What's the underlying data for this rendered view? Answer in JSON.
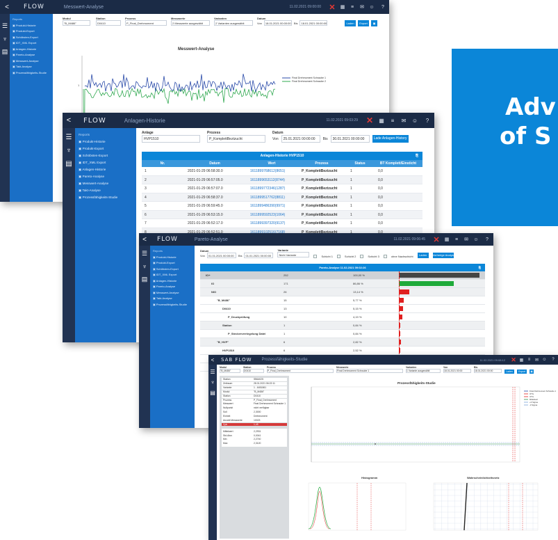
{
  "banner": {
    "line1": "Adv",
    "line2": "of S",
    "color": "#0b86d8"
  },
  "common": {
    "back": "<",
    "brand": "FLOW",
    "menu_title": "Reports",
    "menu_items": [
      "Produkt-Historie",
      "Produkt-Export",
      "Schöbsten-Export",
      "IDT_XML Export",
      "Anlagen-Historie",
      "Pareto-Analyse",
      "Messwert-Analyse",
      "Takt-Analyse",
      "Prozessfähigkeits-Studie"
    ],
    "icons": [
      "database-icon",
      "stethoscope-icon",
      "document-icon"
    ]
  },
  "win1": {
    "subtitle": "Messwert-Analyse",
    "timestamp": "11.02.2021 09:00:00",
    "filters": [
      {
        "label": "Modul",
        "value": "\"B_M486\""
      },
      {
        "label": "Station",
        "value": "D0410"
      },
      {
        "label": "Prozess",
        "value": "P_Final_Drehmoment"
      },
      {
        "label": "Messwerte",
        "value": "2 Messwerte ausgewählt"
      },
      {
        "label": "Varianten",
        "value": "2 Varianten ausgewählt"
      },
      {
        "label": "Datum",
        "value": ""
      }
    ],
    "von": "Von",
    "von_value": "18.01.2021 00:00:00",
    "bis": "Bis",
    "bis_value": "18.01.2021 00:00:00",
    "load": "Laden",
    "export": "Export",
    "chart_title": "Messwert-Analyse",
    "legend": [
      "Final Drehmoment Schraube 1",
      "Final Drehmoment Schraube 2"
    ],
    "ytick": "1"
  },
  "win2": {
    "subtitle": "Anlagen-Historie",
    "timestamp": "11.02.2021 09:03:29",
    "anlage_label": "Anlage",
    "anlage_value": "HVP1510",
    "prozess_label": "Prozess",
    "prozess_value": "P_KomplettBeztzucht",
    "datum_label": "Datum",
    "von": "Von",
    "von_value": "25.01.2021 00:00:00",
    "bis": "Bis",
    "bis_value": "30.01.2021 00:00:00",
    "load": "Lade Anlagen-History",
    "table_title": "Anlagen-Historie HVP1510",
    "columns": [
      "Nr.",
      "Datum",
      "Wert",
      "Prozess",
      "Status",
      "BT Komplett/Einsticht"
    ],
    "rows": [
      [
        "1",
        "2021-01-29 06:58:30.0",
        "1611899768612(8651)",
        "P_KomplettBeztzucht",
        "1",
        "0,0"
      ],
      [
        "2",
        "2021-01-29 06:57:05.0",
        "1611899653112(8744)",
        "P_KomplettBeztzucht",
        "1",
        "0,0"
      ],
      [
        "3",
        "2021-01-29 06:57:07.0",
        "1611899772346(1287)",
        "P_KomplettBeztzucht",
        "1",
        "0,0"
      ],
      [
        "4",
        "2021-01-29 06:58:37.0",
        "1611899517762(8811)",
        "P_KomplettBeztzucht",
        "1",
        "0,0"
      ],
      [
        "5",
        "2021-01-29 06:59:45.0",
        "1611899486390(9971)",
        "P_KomplettBeztzucht",
        "1",
        "0,0"
      ],
      [
        "6",
        "2021-01-29 06:53:15.0",
        "1611899592523(1064)",
        "P_KomplettBeztzucht",
        "1",
        "0,0"
      ],
      [
        "7",
        "2021-01-29 06:52:17.0",
        "1611899397320(9137)",
        "P_KomplettBeztzucht",
        "1",
        "0,0"
      ],
      [
        "8",
        "2021-01-29 06:52:51.0",
        "1611899102516(7168)",
        "P_KomplettBeztzucht",
        "1",
        "0,0"
      ]
    ]
  },
  "win3": {
    "subtitle": "Pareto-Analyse",
    "timestamp": "11.02.2021 09:06:45",
    "datum_label": "Datum",
    "von": "Von",
    "von_value": "01.01.2021 00:00:00",
    "bis": "Bis",
    "bis_value": "01.01.2021 00:00:00",
    "variante_label": "Variante",
    "variante_value": "Nicht Variante",
    "checks": [
      "Schicht 1",
      "Schicht 2",
      "Schicht 3",
      "ohne Nachschicht"
    ],
    "load": "Laden",
    "prev": "Vorherige Analyse",
    "table_title": "Pareto-Analyse 11.02.2021 09:02:26",
    "rows": [
      {
        "label": "IO+",
        "count": "252",
        "pct": "100,00 %",
        "bar": 1.0,
        "color": "#444444",
        "cls": "gray",
        "indent": 1
      },
      {
        "label": "IO",
        "count": "171",
        "pct": "86,86 %",
        "bar": 0.68,
        "color": "#1faa3a",
        "cls": "light",
        "indent": 2
      },
      {
        "label": "NIO",
        "count": "26",
        "pct": "13,14 %",
        "bar": 0.13,
        "color": "#e02020",
        "cls": "light",
        "indent": 2
      },
      {
        "label": "\"B_M486\"",
        "count": "15",
        "pct": "5,77 %",
        "bar": 0.06,
        "color": "#e02020",
        "cls": "",
        "indent": 3
      },
      {
        "label": "D0410",
        "count": "13",
        "pct": "5,15 %",
        "bar": 0.05,
        "color": "#e02020",
        "cls": "",
        "indent": 4
      },
      {
        "label": "P_Druckprüfung",
        "count": "10",
        "pct": "4,19 %",
        "bar": 0.04,
        "color": "#e02020",
        "cls": "",
        "indent": 5
      },
      {
        "label": "Station",
        "count": "1",
        "pct": "0,84 %",
        "bar": 0.0,
        "color": "#e02020",
        "cls": "light",
        "indent": 4
      },
      {
        "label": "P_Steckerverriegelung Datei",
        "count": "1",
        "pct": "0,84 %",
        "bar": 0.0,
        "color": "#e02020",
        "cls": "",
        "indent": 5
      },
      {
        "label": "\"B_HVP\"",
        "count": "6",
        "pct": "2,82 %",
        "bar": 0.03,
        "color": "#e02020",
        "cls": "light",
        "indent": 3
      },
      {
        "label": "HVP1510",
        "count": "6",
        "pct": "2,52 %",
        "bar": 0.02,
        "color": "#e02020",
        "cls": "",
        "indent": 4
      },
      {
        "label": "P_Herunterfuhrt",
        "count": "4",
        "pct": "0,43 %",
        "bar": 0.01,
        "color": "#e02020",
        "cls": "",
        "indent": 5
      },
      {
        "label": "P_Einrasten",
        "count": "1",
        "pct": "0,43 %",
        "bar": 0.01,
        "color": "#e02020",
        "cls": "",
        "indent": 5
      }
    ]
  },
  "win4": {
    "brand": "SAB FLOW",
    "subtitle": "Prozessfähigkeits-Studie",
    "timestamp": "11.02.2021 09:08:12",
    "filters": [
      {
        "label": "Modul",
        "value": "\"B_M486\""
      },
      {
        "label": "Station",
        "value": "D0410"
      },
      {
        "label": "Prozess",
        "value": "P_Final_Drehmoment"
      },
      {
        "label": "Messwerte",
        "value": "Final Drehmoment Schraube 1"
      },
      {
        "label": "Varianten",
        "value": "1 Variante ausgewählt"
      },
      {
        "label": "Von",
        "value": "18.01.2021 00:00"
      },
      {
        "label": "Bis",
        "value": "18.01.2021 00:00"
      }
    ],
    "load": "Laden",
    "export": "Export",
    "info": [
      [
        "Station",
        "SB64025"
      ],
      [
        "Zeitraum",
        "28.01.2021 06:22:11"
      ],
      [
        "Variante",
        "1 - 6451861"
      ],
      [
        "Modul",
        "\"B_M486\""
      ],
      [
        "Station",
        "D0410"
      ],
      [
        "Prozess",
        "P_Final_Drehmoment"
      ],
      [
        "Messwert",
        "Final Drehmoment Schraube 1"
      ],
      [
        "Nullpunkt",
        "nicht verfügbar"
      ],
      [
        "Soll",
        "2,3000"
      ],
      [
        "Einheit",
        "Drehmoment"
      ],
      [
        "Anzahl Messwerte",
        "10023"
      ]
    ],
    "info_red": [
      "Cpk",
      "1,45"
    ],
    "info2": [
      [
        "Mittelwert",
        "2,2931"
      ],
      [
        "Std.Abw.",
        "0,0041"
      ],
      [
        "Min",
        "2,2740"
      ],
      [
        "Max",
        "2,3120"
      ]
    ],
    "chart1_title": "Prozessfähigkeits-Studie",
    "chart2_title": "Histogramm",
    "chart3_title": "Wahrscheinlichkeitsnetz",
    "chart1_legend": [
      "Final Drehmoment Schraube 1",
      "OTG",
      "UTG",
      "Mittelwert",
      "+3 Sigma",
      "-3 Sigma"
    ]
  }
}
